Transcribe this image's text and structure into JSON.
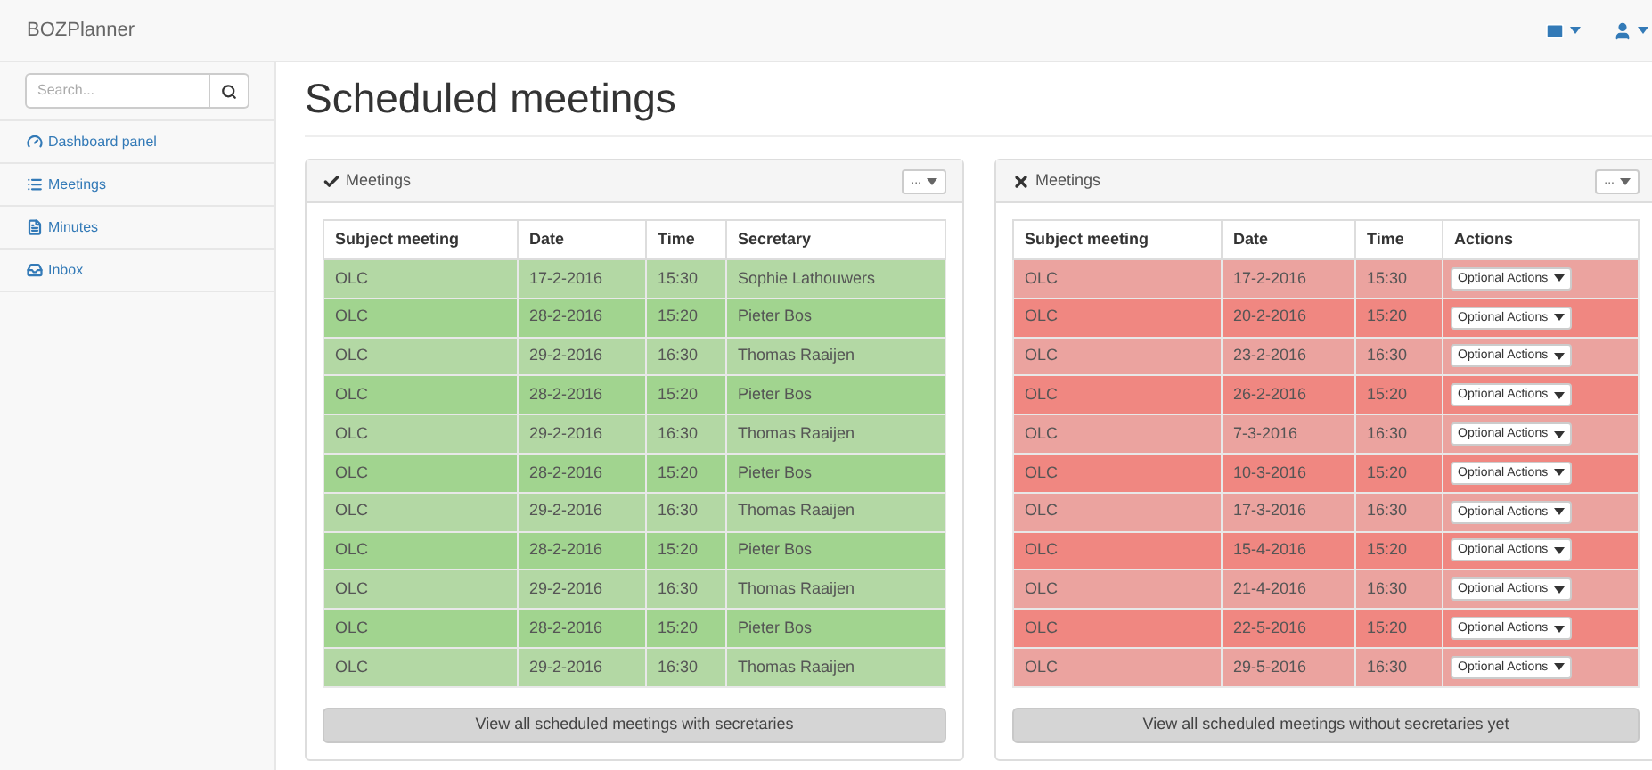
{
  "navbar": {
    "brand": "BOZPlanner"
  },
  "sidebar": {
    "search": {
      "placeholder": "Search..."
    },
    "items": [
      {
        "kind": "dashboard",
        "label": "Dashboard panel"
      },
      {
        "kind": "list",
        "label": "Meetings"
      },
      {
        "kind": "file",
        "label": "Minutes"
      },
      {
        "kind": "inbox",
        "label": "Inbox"
      }
    ]
  },
  "page_title": "Scheduled meetings",
  "panels": [
    {
      "kind": "with_secretary",
      "title": "Meetings",
      "menu": "...",
      "columns": [
        "Subject meeting",
        "Date",
        "Time",
        "Secretary"
      ],
      "rows": [
        {
          "subject": "OLC",
          "date": "17-2-2016",
          "time": "15:30",
          "secretary": "Sophie Lathouwers"
        },
        {
          "subject": "OLC",
          "date": "28-2-2016",
          "time": "15:20",
          "secretary": "Pieter Bos"
        },
        {
          "subject": "OLC",
          "date": "29-2-2016",
          "time": "16:30",
          "secretary": "Thomas Raaijen"
        },
        {
          "subject": "OLC",
          "date": "28-2-2016",
          "time": "15:20",
          "secretary": "Pieter Bos"
        },
        {
          "subject": "OLC",
          "date": "29-2-2016",
          "time": "16:30",
          "secretary": "Thomas Raaijen"
        },
        {
          "subject": "OLC",
          "date": "28-2-2016",
          "time": "15:20",
          "secretary": "Pieter Bos"
        },
        {
          "subject": "OLC",
          "date": "29-2-2016",
          "time": "16:30",
          "secretary": "Thomas Raaijen"
        },
        {
          "subject": "OLC",
          "date": "28-2-2016",
          "time": "15:20",
          "secretary": "Pieter Bos"
        },
        {
          "subject": "OLC",
          "date": "29-2-2016",
          "time": "16:30",
          "secretary": "Thomas Raaijen"
        },
        {
          "subject": "OLC",
          "date": "28-2-2016",
          "time": "15:20",
          "secretary": "Pieter Bos"
        },
        {
          "subject": "OLC",
          "date": "29-2-2016",
          "time": "16:30",
          "secretary": "Thomas Raaijen"
        }
      ],
      "footer_button": "View all scheduled meetings with secretaries"
    },
    {
      "kind": "without_secretary",
      "title": "Meetings",
      "menu": "...",
      "columns": [
        "Subject meeting",
        "Date",
        "Time",
        "Actions"
      ],
      "rows": [
        {
          "subject": "OLC",
          "date": "17-2-2016",
          "time": "15:30",
          "action": "Optional Actions"
        },
        {
          "subject": "OLC",
          "date": "20-2-2016",
          "time": "15:20",
          "action": "Optional Actions"
        },
        {
          "subject": "OLC",
          "date": "23-2-2016",
          "time": "16:30",
          "action": "Optional Actions"
        },
        {
          "subject": "OLC",
          "date": "26-2-2016",
          "time": "15:20",
          "action": "Optional Actions"
        },
        {
          "subject": "OLC",
          "date": "7-3-2016",
          "time": "16:30",
          "action": "Optional Actions"
        },
        {
          "subject": "OLC",
          "date": "10-3-2016",
          "time": "15:20",
          "action": "Optional Actions"
        },
        {
          "subject": "OLC",
          "date": "17-3-2016",
          "time": "16:30",
          "action": "Optional Actions"
        },
        {
          "subject": "OLC",
          "date": "15-4-2016",
          "time": "15:20",
          "action": "Optional Actions"
        },
        {
          "subject": "OLC",
          "date": "21-4-2016",
          "time": "16:30",
          "action": "Optional Actions"
        },
        {
          "subject": "OLC",
          "date": "22-5-2016",
          "time": "15:20",
          "action": "Optional Actions"
        },
        {
          "subject": "OLC",
          "date": "29-5-2016",
          "time": "16:30",
          "action": "Optional Actions"
        }
      ],
      "footer_button": "View all scheduled meetings without secretaries yet"
    }
  ]
}
